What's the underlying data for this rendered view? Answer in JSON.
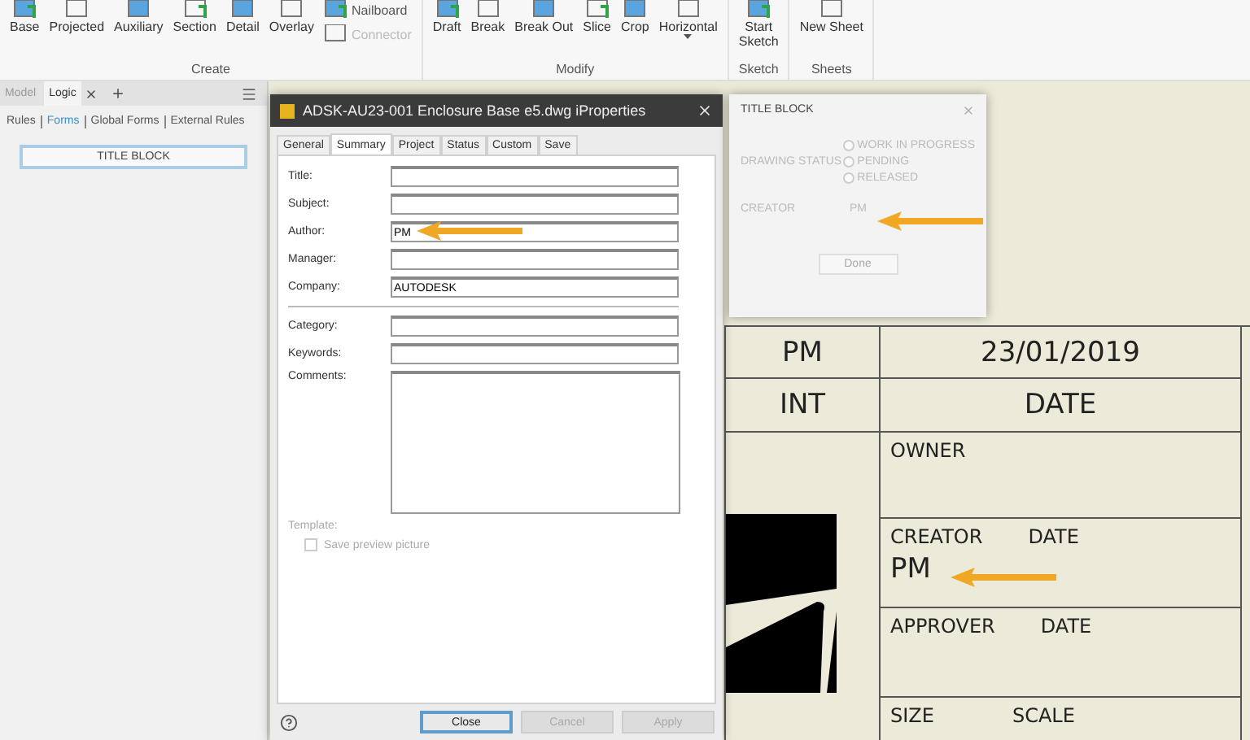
{
  "ribbon": {
    "groups": [
      {
        "label": "Create",
        "tools": [
          {
            "label": "Base",
            "kind": "large"
          },
          {
            "label": "Projected",
            "kind": "large"
          },
          {
            "label": "Auxiliary",
            "kind": "large"
          },
          {
            "label": "Section",
            "kind": "large"
          },
          {
            "label": "Detail",
            "kind": "large"
          },
          {
            "label": "Overlay",
            "kind": "large"
          },
          {
            "label": "Nailboard",
            "kind": "small",
            "disabled": false
          },
          {
            "label": "Connector",
            "kind": "small",
            "disabled": true
          }
        ]
      },
      {
        "label": "Modify",
        "tools": [
          {
            "label": "Draft",
            "kind": "large"
          },
          {
            "label": "Break",
            "kind": "large"
          },
          {
            "label": "Break Out",
            "kind": "large"
          },
          {
            "label": "Slice",
            "kind": "large"
          },
          {
            "label": "Crop",
            "kind": "large"
          },
          {
            "label": "Horizontal",
            "kind": "dropdown"
          }
        ]
      },
      {
        "label": "Sketch",
        "tools": [
          {
            "label": "Start\nSketch",
            "kind": "large"
          }
        ]
      },
      {
        "label": "Sheets",
        "tools": [
          {
            "label": "New Sheet",
            "kind": "large"
          }
        ]
      }
    ]
  },
  "browser": {
    "tabs": [
      {
        "label": "Model",
        "selected": false
      },
      {
        "label": "Logic",
        "selected": true
      }
    ],
    "links": [
      {
        "label": "Rules",
        "selected": false
      },
      {
        "label": "Forms",
        "selected": true
      },
      {
        "label": "Global Forms",
        "selected": false
      },
      {
        "label": "External Rules",
        "selected": false
      }
    ],
    "form_button": "TITLE BLOCK"
  },
  "iproperties": {
    "title": "ADSK-AU23-001 Enclosure Base e5.dwg iProperties",
    "tabs": [
      {
        "label": "General",
        "selected": false
      },
      {
        "label": "Summary",
        "selected": true
      },
      {
        "label": "Project",
        "selected": false
      },
      {
        "label": "Status",
        "selected": false
      },
      {
        "label": "Custom",
        "selected": false
      },
      {
        "label": "Save",
        "selected": false
      }
    ],
    "fields": [
      {
        "label": "Title:"
      },
      {
        "label": "Subject:"
      },
      {
        "label": "Author:",
        "value": "PM"
      },
      {
        "label": "Manager:"
      },
      {
        "label": "Company:",
        "value": "AUTODESK"
      }
    ],
    "more_fields": [
      {
        "label": "Category:"
      },
      {
        "label": "Keywords:"
      }
    ],
    "comments_label": "Comments:",
    "template_label": "Template:",
    "preview_checkbox": {
      "label": "Save preview picture",
      "checked": false,
      "disabled": true
    },
    "buttons": [
      {
        "label": "Close",
        "disabled": false
      },
      {
        "label": "Cancel",
        "disabled": true
      },
      {
        "label": "Apply",
        "disabled": true
      }
    ]
  },
  "title_block_form": {
    "title": "TITLE BLOCK",
    "status_label": "DRAWING STATUS",
    "options": [
      {
        "label": "WORK IN PROGRESS",
        "selected": false
      },
      {
        "label": "PENDING",
        "selected": false
      },
      {
        "label": "RELEASED",
        "selected": false
      }
    ],
    "creator_label": "CREATOR",
    "creator_value": "PM",
    "done": "Done"
  },
  "drawing": {
    "initials": "PM",
    "date": "23/01/2019",
    "initials_header": "INT",
    "date_header": "DATE",
    "owner": "OWNER",
    "creator": "CREATOR",
    "creator_date": "DATE",
    "creator_value": "PM",
    "approver": "APPROVER",
    "approver_date": "DATE",
    "size": "SIZE",
    "scale": "SCALE"
  }
}
